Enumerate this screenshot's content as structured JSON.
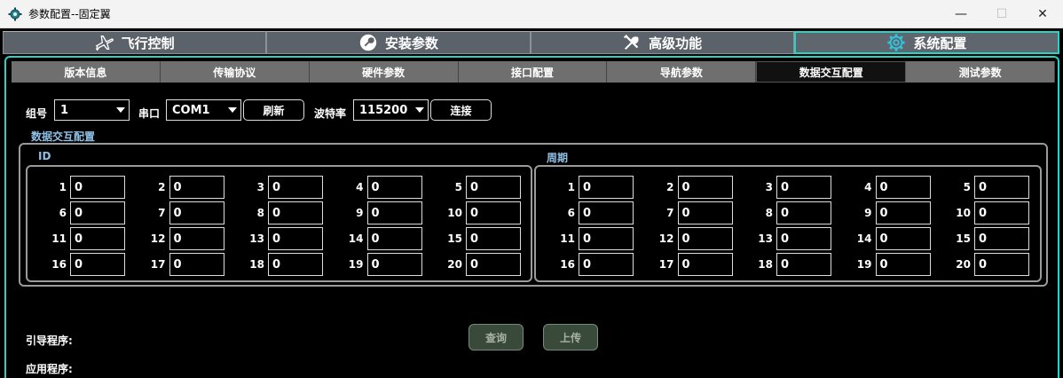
{
  "window": {
    "title": "参数配置--固定翼",
    "minimize": "—",
    "maximize": "☐",
    "close": "✕"
  },
  "main_tabs": [
    {
      "label": "飞行控制",
      "icon": "airplane-icon"
    },
    {
      "label": "安装参数",
      "icon": "wrench-circle-icon"
    },
    {
      "label": "高级功能",
      "icon": "tools-icon"
    },
    {
      "label": "系统配置",
      "icon": "gear-icon"
    }
  ],
  "active_main_tab": 3,
  "sub_tabs": [
    "版本信息",
    "传输协议",
    "硬件参数",
    "接口配置",
    "导航参数",
    "数据交互配置",
    "测试参数"
  ],
  "active_sub_tab": 5,
  "controls": {
    "group_label": "组号",
    "group_value": "1",
    "port_label": "串口",
    "port_value": "COM1",
    "refresh_label": "刷新",
    "baud_label": "波特率",
    "baud_value": "115200",
    "connect_label": "连接"
  },
  "section_title": "数据交互配置",
  "id_group": {
    "title": "ID",
    "values": [
      "0",
      "0",
      "0",
      "0",
      "0",
      "0",
      "0",
      "0",
      "0",
      "0",
      "0",
      "0",
      "0",
      "0",
      "0",
      "0",
      "0",
      "0",
      "0",
      "0"
    ]
  },
  "period_group": {
    "title": "周期",
    "values": [
      "0",
      "0",
      "0",
      "0",
      "0",
      "0",
      "0",
      "0",
      "0",
      "0",
      "0",
      "0",
      "0",
      "0",
      "0",
      "0",
      "0",
      "0",
      "0",
      "0"
    ]
  },
  "row_numbers": [
    "1",
    "2",
    "3",
    "4",
    "5",
    "6",
    "7",
    "8",
    "9",
    "10",
    "11",
    "12",
    "13",
    "14",
    "15",
    "16",
    "17",
    "18",
    "19",
    "20"
  ],
  "bottom": {
    "boot_label": "引导程序:",
    "app_label": "应用程序:",
    "query_label": "查询",
    "upload_label": "上传"
  },
  "colors": {
    "accent": "#27d3c4",
    "group_title": "#8fc0e6"
  }
}
